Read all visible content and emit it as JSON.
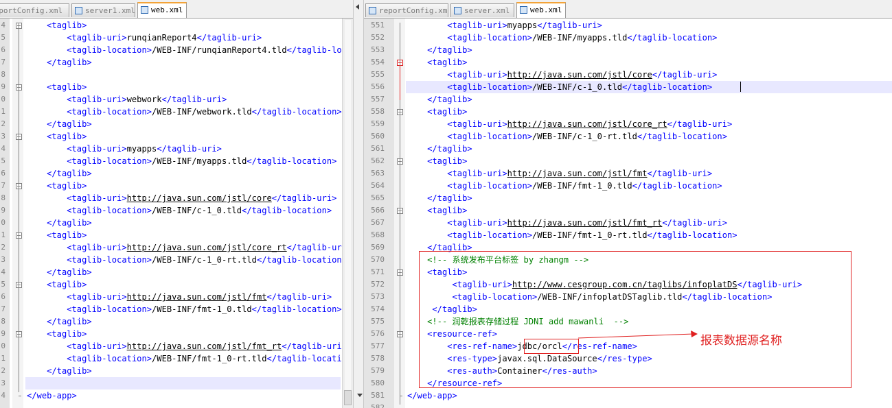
{
  "left": {
    "tabs": [
      {
        "label": "reportConfig.xml",
        "active": false,
        "icon": "file-icon"
      },
      {
        "label": "server1.xml",
        "active": false,
        "icon": "file-icon"
      },
      {
        "label": "web.xml",
        "active": true,
        "icon": "file-icon"
      }
    ],
    "lines": [
      {
        "n": "4",
        "fold": "open",
        "t": [
          [
            "tag",
            "    <taglib>"
          ]
        ]
      },
      {
        "n": "5",
        "t": [
          [
            "tag",
            "        <taglib-uri>"
          ],
          [
            "txt",
            "runqianReport4"
          ],
          [
            "tag",
            "</taglib-uri>"
          ]
        ]
      },
      {
        "n": "6",
        "t": [
          [
            "tag",
            "        <taglib-location>"
          ],
          [
            "txt",
            "/WEB-INF/runqianReport4.tld"
          ],
          [
            "tag",
            "</taglib-location>"
          ]
        ]
      },
      {
        "n": "7",
        "t": [
          [
            "tag",
            "    </taglib>"
          ]
        ]
      },
      {
        "n": "8",
        "t": []
      },
      {
        "n": "9",
        "fold": "open",
        "t": [
          [
            "tag",
            "    <taglib>"
          ]
        ]
      },
      {
        "n": "0",
        "t": [
          [
            "tag",
            "        <taglib-uri>"
          ],
          [
            "txt",
            "webwork"
          ],
          [
            "tag",
            "</taglib-uri>"
          ]
        ]
      },
      {
        "n": "1",
        "t": [
          [
            "tag",
            "        <taglib-location>"
          ],
          [
            "txt",
            "/WEB-INF/webwork.tld"
          ],
          [
            "tag",
            "</taglib-location>"
          ]
        ]
      },
      {
        "n": "2",
        "t": [
          [
            "tag",
            "    </taglib>"
          ]
        ]
      },
      {
        "n": "3",
        "fold": "open",
        "t": [
          [
            "tag",
            "    <taglib>"
          ]
        ]
      },
      {
        "n": "4",
        "t": [
          [
            "tag",
            "        <taglib-uri>"
          ],
          [
            "txt",
            "myapps"
          ],
          [
            "tag",
            "</taglib-uri>"
          ]
        ]
      },
      {
        "n": "5",
        "t": [
          [
            "tag",
            "        <taglib-location>"
          ],
          [
            "txt",
            "/WEB-INF/myapps.tld"
          ],
          [
            "tag",
            "</taglib-location>"
          ]
        ]
      },
      {
        "n": "6",
        "t": [
          [
            "tag",
            "    </taglib>"
          ]
        ]
      },
      {
        "n": "7",
        "fold": "open",
        "t": [
          [
            "tag",
            "    <taglib>"
          ]
        ]
      },
      {
        "n": "8",
        "t": [
          [
            "tag",
            "        <taglib-uri>"
          ],
          [
            "url",
            "http://java.sun.com/jstl/core"
          ],
          [
            "tag",
            "</taglib-uri>"
          ]
        ]
      },
      {
        "n": "9",
        "t": [
          [
            "tag",
            "        <taglib-location>"
          ],
          [
            "txt",
            "/WEB-INF/c-1_0.tld"
          ],
          [
            "tag",
            "</taglib-location>"
          ]
        ]
      },
      {
        "n": "0",
        "t": [
          [
            "tag",
            "    </taglib>"
          ]
        ]
      },
      {
        "n": "1",
        "fold": "open",
        "t": [
          [
            "tag",
            "    <taglib>"
          ]
        ]
      },
      {
        "n": "2",
        "t": [
          [
            "tag",
            "        <taglib-uri>"
          ],
          [
            "url",
            "http://java.sun.com/jstl/core_rt"
          ],
          [
            "tag",
            "</taglib-uri>"
          ]
        ]
      },
      {
        "n": "3",
        "t": [
          [
            "tag",
            "        <taglib-location>"
          ],
          [
            "txt",
            "/WEB-INF/c-1_0-rt.tld"
          ],
          [
            "tag",
            "</taglib-location>"
          ]
        ]
      },
      {
        "n": "4",
        "t": [
          [
            "tag",
            "    </taglib>"
          ]
        ]
      },
      {
        "n": "5",
        "fold": "open",
        "t": [
          [
            "tag",
            "    <taglib>"
          ]
        ]
      },
      {
        "n": "6",
        "t": [
          [
            "tag",
            "        <taglib-uri>"
          ],
          [
            "url",
            "http://java.sun.com/jstl/fmt"
          ],
          [
            "tag",
            "</taglib-uri>"
          ]
        ]
      },
      {
        "n": "7",
        "t": [
          [
            "tag",
            "        <taglib-location>"
          ],
          [
            "txt",
            "/WEB-INF/fmt-1_0.tld"
          ],
          [
            "tag",
            "</taglib-location>"
          ]
        ]
      },
      {
        "n": "8",
        "t": [
          [
            "tag",
            "    </taglib>"
          ]
        ]
      },
      {
        "n": "9",
        "fold": "open",
        "t": [
          [
            "tag",
            "    <taglib>"
          ]
        ]
      },
      {
        "n": "0",
        "t": [
          [
            "tag",
            "        <taglib-uri>"
          ],
          [
            "url",
            "http://java.sun.com/jstl/fmt_rt"
          ],
          [
            "tag",
            "</taglib-uri>"
          ]
        ]
      },
      {
        "n": "1",
        "t": [
          [
            "tag",
            "        <taglib-location>"
          ],
          [
            "txt",
            "/WEB-INF/fmt-1_0-rt.tld"
          ],
          [
            "tag",
            "</taglib-location>"
          ]
        ]
      },
      {
        "n": "2",
        "t": [
          [
            "tag",
            "    </taglib>"
          ]
        ]
      },
      {
        "n": "3",
        "hl": true,
        "t": []
      },
      {
        "n": "4",
        "fold": "end",
        "t": [
          [
            "tag",
            "</web-app>"
          ]
        ]
      }
    ]
  },
  "right": {
    "tabs": [
      {
        "label": "reportConfig.xml",
        "active": false,
        "icon": "file-icon"
      },
      {
        "label": "server.xml",
        "active": false,
        "icon": "file-icon"
      },
      {
        "label": "web.xml",
        "active": true,
        "icon": "file-icon"
      }
    ],
    "lines": [
      {
        "n": "551",
        "t": [
          [
            "tag",
            "        <taglib-uri>"
          ],
          [
            "txt",
            "myapps"
          ],
          [
            "tag",
            "</taglib-uri>"
          ]
        ]
      },
      {
        "n": "552",
        "t": [
          [
            "tag",
            "        <taglib-location>"
          ],
          [
            "txt",
            "/WEB-INF/myapps.tld"
          ],
          [
            "tag",
            "</taglib-location>"
          ]
        ]
      },
      {
        "n": "553",
        "t": [
          [
            "tag",
            "    </taglib>"
          ]
        ]
      },
      {
        "n": "554",
        "fold": "red",
        "t": [
          [
            "tag",
            "    <taglib>"
          ]
        ]
      },
      {
        "n": "555",
        "t": [
          [
            "tag",
            "        <taglib-uri>"
          ],
          [
            "url",
            "http://java.sun.com/jstl/core"
          ],
          [
            "tag",
            "</taglib-uri>"
          ]
        ]
      },
      {
        "n": "556",
        "hl": true,
        "t": [
          [
            "tag",
            "        <taglib-location>"
          ],
          [
            "txt",
            "/WEB-INF/c-1_0.tld"
          ],
          [
            "tag",
            "</taglib-location>"
          ]
        ]
      },
      {
        "n": "557",
        "t": [
          [
            "tag",
            "    </taglib>"
          ]
        ]
      },
      {
        "n": "558",
        "fold": "open",
        "t": [
          [
            "tag",
            "    <taglib>"
          ]
        ]
      },
      {
        "n": "559",
        "t": [
          [
            "tag",
            "        <taglib-uri>"
          ],
          [
            "url",
            "http://java.sun.com/jstl/core_rt"
          ],
          [
            "tag",
            "</taglib-uri>"
          ]
        ]
      },
      {
        "n": "560",
        "t": [
          [
            "tag",
            "        <taglib-location>"
          ],
          [
            "txt",
            "/WEB-INF/c-1_0-rt.tld"
          ],
          [
            "tag",
            "</taglib-location>"
          ]
        ]
      },
      {
        "n": "561",
        "t": [
          [
            "tag",
            "    </taglib>"
          ]
        ]
      },
      {
        "n": "562",
        "fold": "open",
        "t": [
          [
            "tag",
            "    <taglib>"
          ]
        ]
      },
      {
        "n": "563",
        "t": [
          [
            "tag",
            "        <taglib-uri>"
          ],
          [
            "url",
            "http://java.sun.com/jstl/fmt"
          ],
          [
            "tag",
            "</taglib-uri>"
          ]
        ]
      },
      {
        "n": "564",
        "t": [
          [
            "tag",
            "        <taglib-location>"
          ],
          [
            "txt",
            "/WEB-INF/fmt-1_0.tld"
          ],
          [
            "tag",
            "</taglib-location>"
          ]
        ]
      },
      {
        "n": "565",
        "t": [
          [
            "tag",
            "    </taglib>"
          ]
        ]
      },
      {
        "n": "566",
        "fold": "open",
        "t": [
          [
            "tag",
            "    <taglib>"
          ]
        ]
      },
      {
        "n": "567",
        "t": [
          [
            "tag",
            "        <taglib-uri>"
          ],
          [
            "url",
            "http://java.sun.com/jstl/fmt_rt"
          ],
          [
            "tag",
            "</taglib-uri>"
          ]
        ]
      },
      {
        "n": "568",
        "t": [
          [
            "tag",
            "        <taglib-location>"
          ],
          [
            "txt",
            "/WEB-INF/fmt-1_0-rt.tld"
          ],
          [
            "tag",
            "</taglib-location>"
          ]
        ]
      },
      {
        "n": "569",
        "t": [
          [
            "tag",
            "    </taglib>"
          ]
        ]
      },
      {
        "n": "570",
        "t": [
          [
            "cmt",
            "    <!-- 系统发布平台标签 by zhangm -->"
          ]
        ]
      },
      {
        "n": "571",
        "fold": "open",
        "t": [
          [
            "tag",
            "    <taglib>"
          ]
        ]
      },
      {
        "n": "572",
        "t": [
          [
            "tag",
            "         <taglib-uri>"
          ],
          [
            "url",
            "http://www.cesgroup.com.cn/taglibs/infoplatDS"
          ],
          [
            "tag",
            "</taglib-uri>"
          ]
        ]
      },
      {
        "n": "573",
        "t": [
          [
            "tag",
            "         <taglib-location>"
          ],
          [
            "txt",
            "/WEB-INF/infoplatDSTaglib.tld"
          ],
          [
            "tag",
            "</taglib-location>"
          ]
        ]
      },
      {
        "n": "574",
        "t": [
          [
            "tag",
            "     </taglib>"
          ]
        ]
      },
      {
        "n": "575",
        "t": [
          [
            "cmt",
            "    <!-- 润乾报表存储过程 JDNI add mawanli  -->"
          ]
        ]
      },
      {
        "n": "576",
        "fold": "open",
        "t": [
          [
            "tag",
            "    <resource-ref>"
          ]
        ]
      },
      {
        "n": "577",
        "t": [
          [
            "tag",
            "        <res-ref-name>"
          ],
          [
            "txt",
            "jdbc/orcl"
          ],
          [
            "tag",
            "</res-ref-name>"
          ]
        ]
      },
      {
        "n": "578",
        "t": [
          [
            "tag",
            "        <res-type>"
          ],
          [
            "txt",
            "javax.sql.DataSource"
          ],
          [
            "tag",
            "</res-type>"
          ]
        ]
      },
      {
        "n": "579",
        "t": [
          [
            "tag",
            "        <res-auth>"
          ],
          [
            "txt",
            "Container"
          ],
          [
            "tag",
            "</res-auth>"
          ]
        ]
      },
      {
        "n": "580",
        "t": [
          [
            "tag",
            "    </resource-ref>"
          ]
        ]
      },
      {
        "n": "581",
        "fold": "end",
        "t": [
          [
            "tag",
            "</web-app>"
          ]
        ]
      },
      {
        "n": "582",
        "t": []
      }
    ]
  },
  "annotation": {
    "label": "报表数据源名称",
    "color": "#e02020"
  },
  "colors": {
    "tag": "#0000ff",
    "comment": "#008000",
    "text": "#000000",
    "highlight": "#e8e8ff",
    "annotation": "#e02020"
  }
}
